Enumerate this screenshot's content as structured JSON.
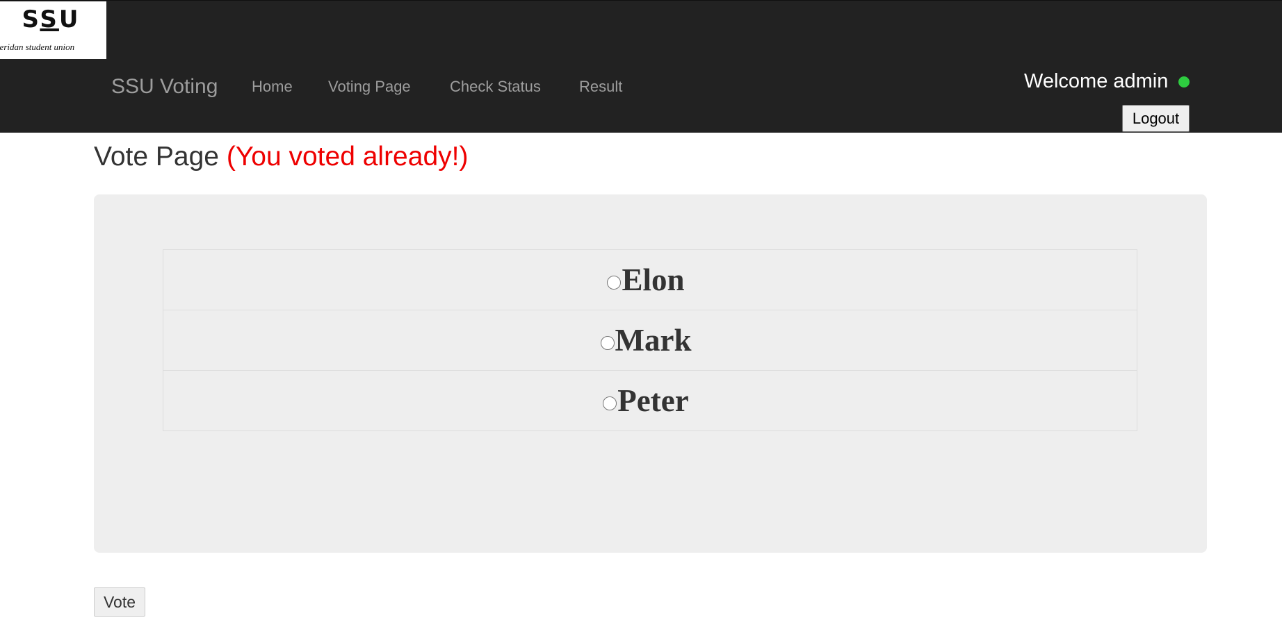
{
  "logo": {
    "mark_s1": "S",
    "mark_s2": "S",
    "mark_u": "U",
    "subtitle": "sheridan student union"
  },
  "navbar": {
    "brand": "SSU Voting",
    "links": [
      "Home",
      "Voting Page",
      "Check Status",
      "Result"
    ],
    "welcome": "Welcome admin",
    "status_color": "#2ecc40",
    "logout_label": "Logout"
  },
  "page": {
    "title": "Vote Page",
    "warning": "(You voted already!)",
    "warning_color": "#ee0000"
  },
  "candidates": [
    {
      "name": "Elon",
      "selected": false
    },
    {
      "name": "Mark",
      "selected": false
    },
    {
      "name": "Peter",
      "selected": false
    }
  ],
  "vote_button_label": "Vote"
}
